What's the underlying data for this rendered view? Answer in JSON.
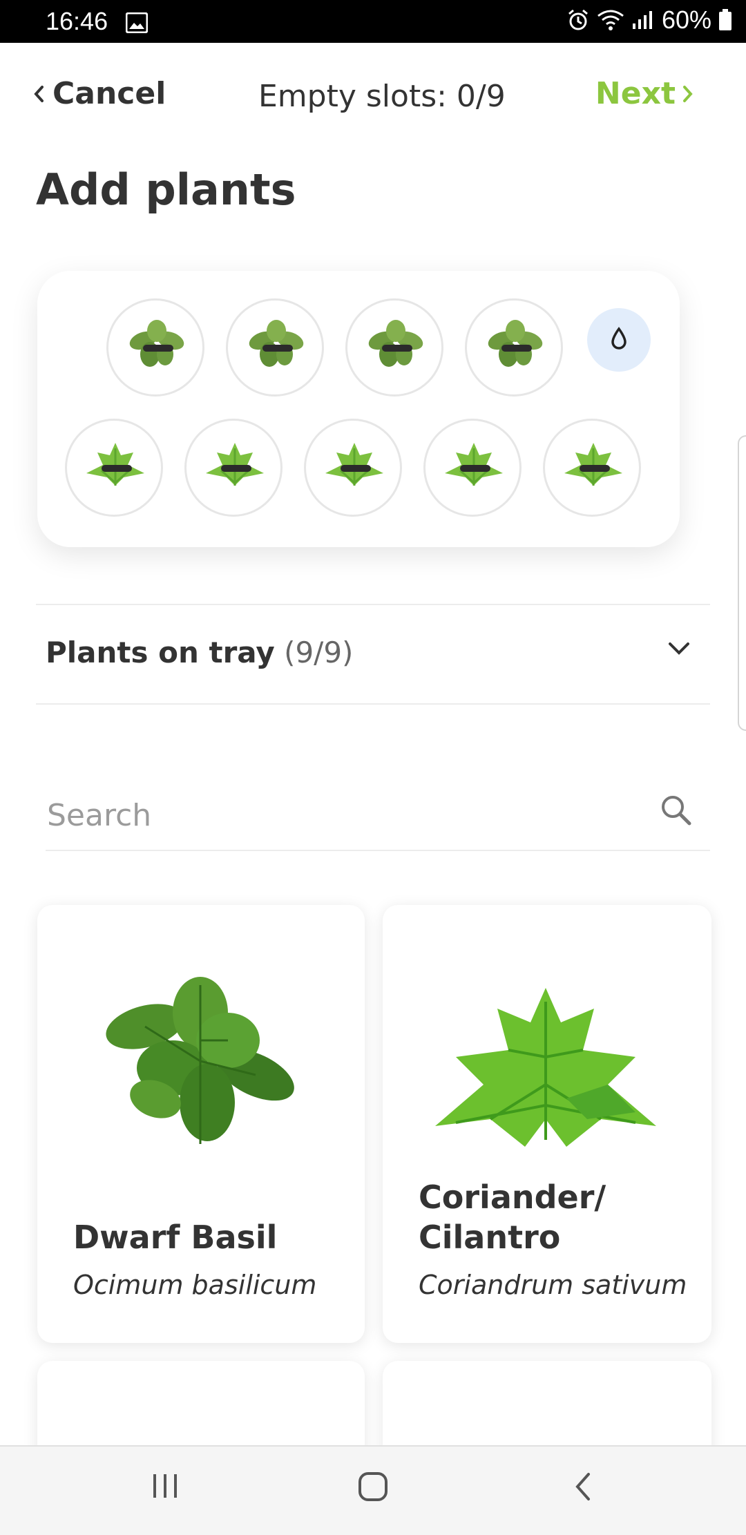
{
  "status_bar": {
    "time": "16:46",
    "battery": "60%",
    "icons": [
      "gallery-icon",
      "alarm-icon",
      "wifi-icon",
      "signal-icon",
      "battery-icon"
    ]
  },
  "nav": {
    "cancel_label": "Cancel",
    "slots_text": "Empty slots: 0/9",
    "next_label": "Next",
    "accent_color": "#8cc63f"
  },
  "page_title": "Add plants",
  "tray": {
    "slots": [
      {
        "plant": "Dwarf Basil"
      },
      {
        "plant": "Dwarf Basil"
      },
      {
        "plant": "Dwarf Basil"
      },
      {
        "plant": "Dwarf Basil"
      },
      {
        "plant": "Coriander/Cilantro"
      },
      {
        "plant": "Coriander/Cilantro"
      },
      {
        "plant": "Coriander/Cilantro"
      },
      {
        "plant": "Coriander/Cilantro"
      },
      {
        "plant": "Coriander/Cilantro"
      }
    ],
    "water_icon": "water-drop-icon"
  },
  "plants_on_tray": {
    "label": "Plants on tray",
    "count": "(9/9)"
  },
  "search": {
    "placeholder": "Search",
    "value": ""
  },
  "plants": [
    {
      "name": "Dwarf Basil",
      "latin": "Ocimum basilicum"
    },
    {
      "name_line1": "Coriander/",
      "name_line2": "Cilantro",
      "latin": "Coriandrum sativum"
    }
  ],
  "colors": {
    "accent": "#8cc63f",
    "water_bg": "#e2edfb",
    "text": "#333333"
  }
}
